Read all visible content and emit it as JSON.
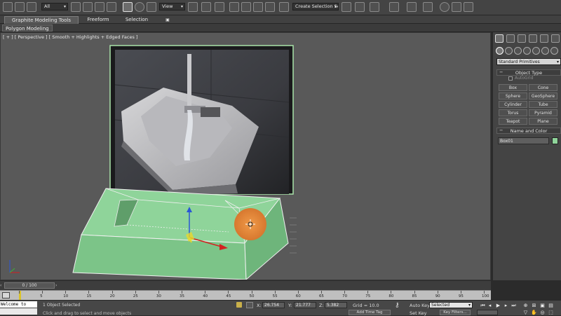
{
  "colors": {
    "viewport_bg": "#595959",
    "selection_green": "#8fd49a",
    "gizmo_orange": "#e2873a",
    "axis_x": "#d42020",
    "axis_y": "#3ab53a",
    "axis_z": "#2a56d6"
  },
  "toolbar": {
    "selection_filter": "All",
    "reference_coord": "View",
    "named_selection_placeholder": "Create Selection Se",
    "icons": [
      "undo-icon",
      "redo-icon",
      "link-icon",
      "unlink-icon",
      "bind-spacewarp-icon",
      "select-object-icon",
      "select-by-name-icon",
      "rectangular-selection-icon",
      "window-crossing-icon",
      "select-move-icon",
      "select-rotate-icon",
      "select-scale-icon",
      "pivot-center-icon",
      "select-manipulate-icon",
      "keyboard-shortcut-icon",
      "snaps-toggle-icon",
      "angle-snap-icon",
      "percent-snap-icon",
      "spinner-snap-icon",
      "edit-named-selection-icon",
      "mirror-icon",
      "align-icon",
      "layer-manager-icon",
      "graphite-toggle-icon",
      "curve-editor-icon",
      "schematic-view-icon",
      "material-editor-icon",
      "render-setup-icon",
      "rendered-frame-icon",
      "render-production-icon"
    ]
  },
  "ribbon": {
    "tabs": [
      {
        "label": "Graphite Modeling Tools",
        "active": true
      },
      {
        "label": "Freeform",
        "active": false
      },
      {
        "label": "Selection",
        "active": false
      }
    ],
    "panel_label": "Polygon Modeling"
  },
  "viewport": {
    "label": "[ + ] [ Perspective ] [ Smooth + Highlights + Edged Faces ]",
    "reference_plane_content": "reference-image-sink-with-faucet",
    "selected_object": "box-editable-poly"
  },
  "command_panel": {
    "tabs": [
      "create-tab-icon",
      "modify-tab-icon",
      "hierarchy-tab-icon",
      "motion-tab-icon",
      "display-tab-icon",
      "utilities-tab-icon"
    ],
    "categories": [
      "geometry-icon",
      "shapes-icon",
      "lights-icon",
      "cameras-icon",
      "helpers-icon",
      "space-warps-icon",
      "systems-icon"
    ],
    "primitive_type": "Standard Primitives",
    "object_type_title": "Object Type",
    "autogrid_label": "AutoGrid",
    "buttons": [
      "Box",
      "Cone",
      "Sphere",
      "GeoSphere",
      "Cylinder",
      "Tube",
      "Torus",
      "Pyramid",
      "Teapot",
      "Plane"
    ],
    "name_color_title": "Name and Color",
    "object_name": "Box01"
  },
  "timeline": {
    "slider_label": "0 / 100",
    "ticks": [
      0,
      5,
      10,
      15,
      20,
      25,
      30,
      35,
      40,
      45,
      50,
      55,
      60,
      65,
      70,
      75,
      80,
      85,
      90,
      95,
      100
    ]
  },
  "status": {
    "maxscript_text": "Welcome to MAX!",
    "selection_count": "1 Object Selected",
    "prompt": "Click and drag to select and move objects",
    "x_label": "X:",
    "x_value": "26.754",
    "y_label": "Y:",
    "y_value": "21.777",
    "z_label": "Z:",
    "z_value": "5.382",
    "grid": "Grid = 10.0",
    "add_time_tag": "Add Time Tag",
    "auto_key": "Auto Key",
    "set_key": "Set Key",
    "key_mode": "Selected",
    "key_filters": "Key Filters..."
  }
}
